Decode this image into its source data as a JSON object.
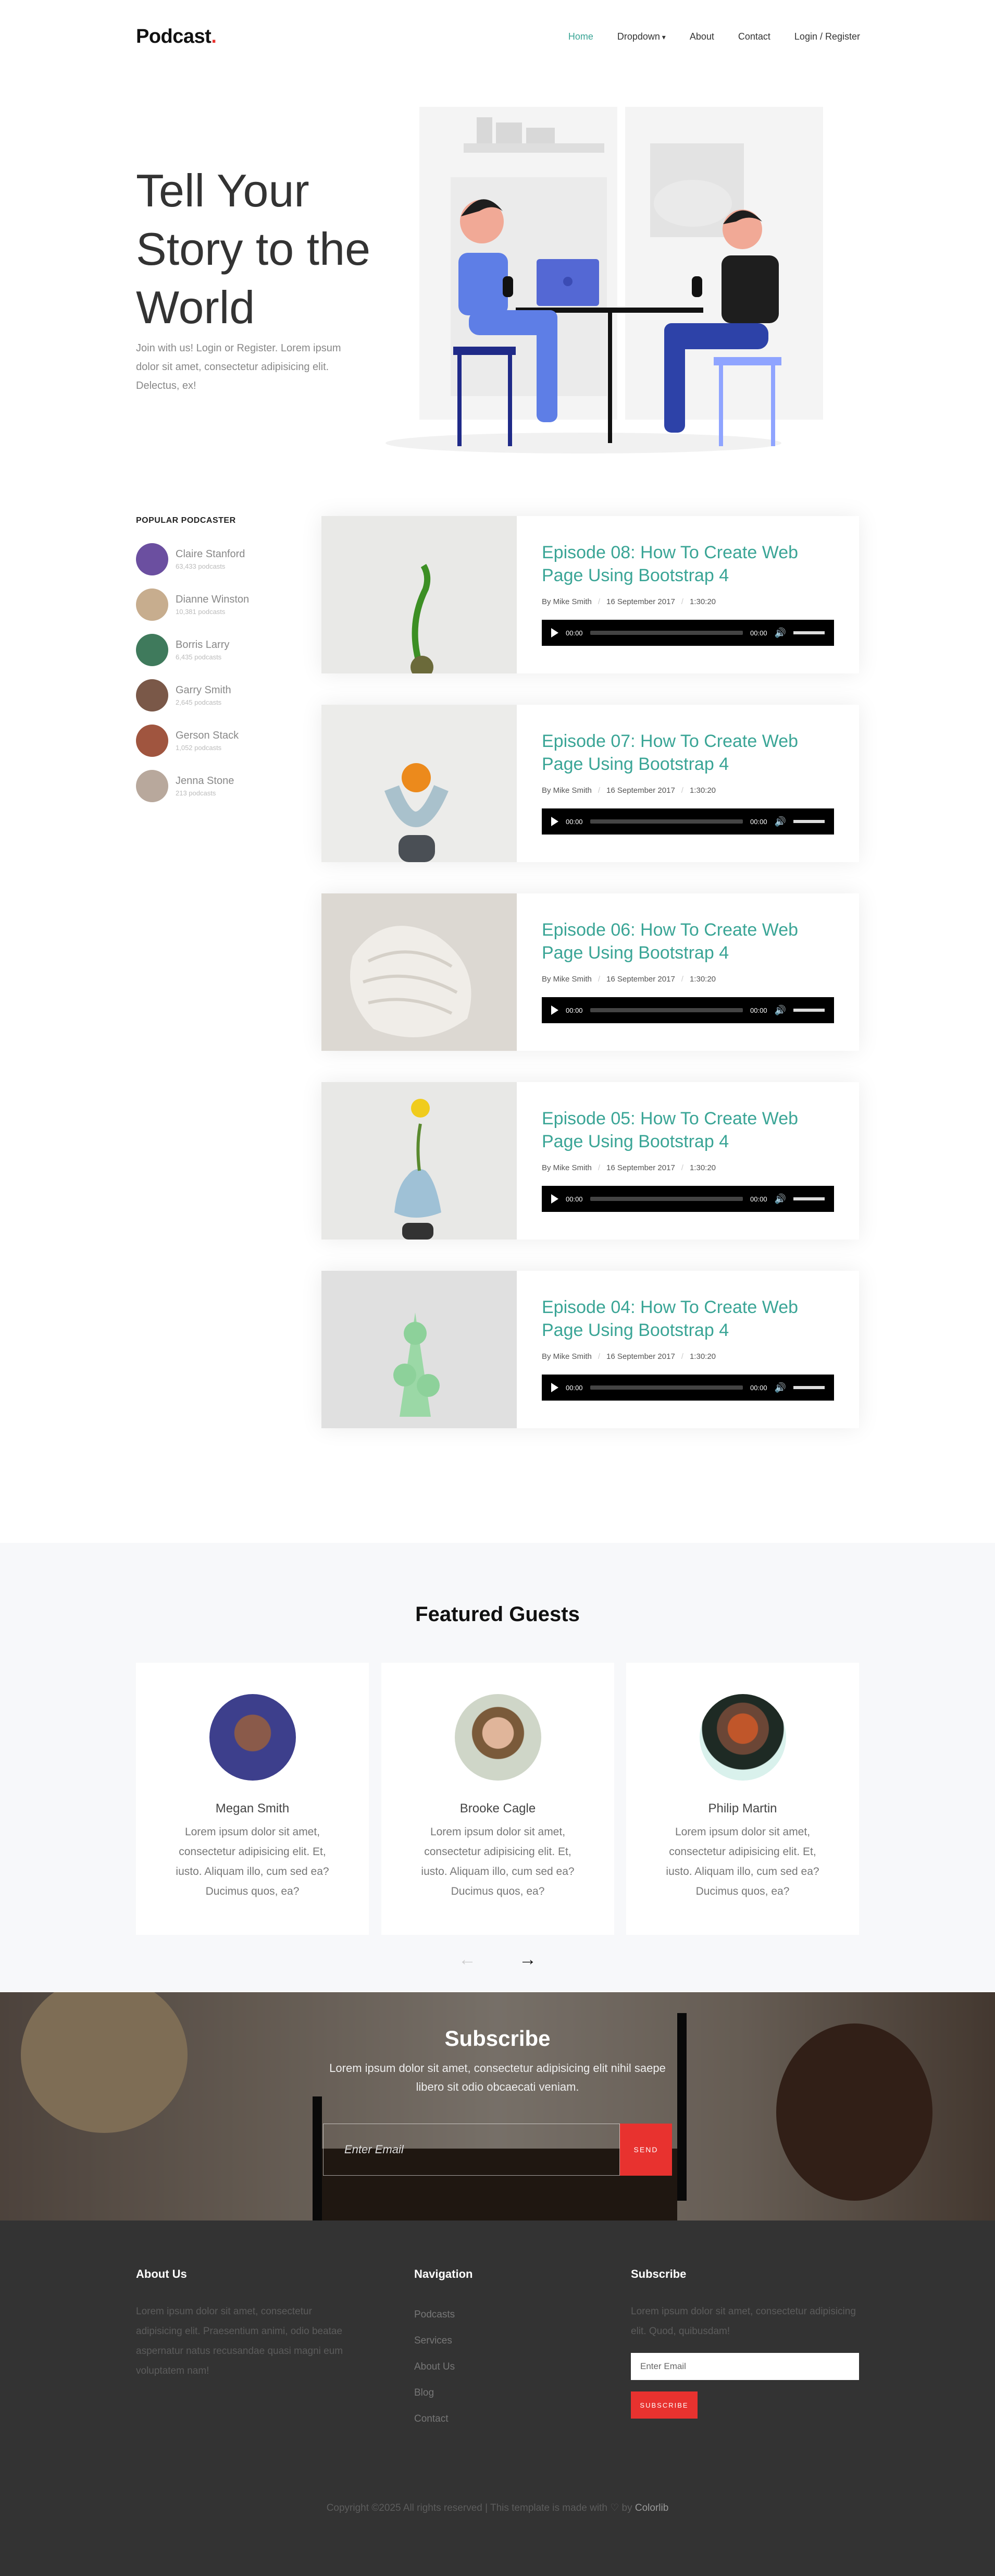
{
  "nav": {
    "logo": "Podcast",
    "logo_dot": ".",
    "items": [
      "Home",
      "Dropdown",
      "About",
      "Contact",
      "Login / Register"
    ]
  },
  "hero": {
    "title": "Tell Your Story to the World",
    "text": "Join with us! Login or Register. Lorem ipsum dolor sit amet, consectetur adipisicing elit. Delectus, ex!"
  },
  "popular": {
    "title": "POPULAR PODCASTER",
    "items": [
      {
        "name": "Claire Stanford",
        "count": "63,433 podcasts"
      },
      {
        "name": "Dianne Winston",
        "count": "10,381 podcasts"
      },
      {
        "name": "Borris Larry",
        "count": "6,435 podcasts"
      },
      {
        "name": "Garry Smith",
        "count": "2,645 podcasts"
      },
      {
        "name": "Gerson Stack",
        "count": "1,052 podcasts"
      },
      {
        "name": "Jenna Stone",
        "count": "213 podcasts"
      }
    ]
  },
  "episodes": [
    {
      "title": "Episode 08: How To Create Web Page Using Bootstrap 4",
      "author": "By Mike Smith",
      "date": "16 September 2017",
      "duration": "1:30:20",
      "time": "00:00",
      "end": "00:00"
    },
    {
      "title": "Episode 07: How To Create Web Page Using Bootstrap 4",
      "author": "By Mike Smith",
      "date": "16 September 2017",
      "duration": "1:30:20",
      "time": "00:00",
      "end": "00:00"
    },
    {
      "title": "Episode 06: How To Create Web Page Using Bootstrap 4",
      "author": "By Mike Smith",
      "date": "16 September 2017",
      "duration": "1:30:20",
      "time": "00:00",
      "end": "00:00"
    },
    {
      "title": "Episode 05: How To Create Web Page Using Bootstrap 4",
      "author": "By Mike Smith",
      "date": "16 September 2017",
      "duration": "1:30:20",
      "time": "00:00",
      "end": "00:00"
    },
    {
      "title": "Episode 04: How To Create Web Page Using Bootstrap 4",
      "author": "By Mike Smith",
      "date": "16 September 2017",
      "duration": "1:30:20",
      "time": "00:00",
      "end": "00:00"
    }
  ],
  "featured": {
    "title": "Featured Guests",
    "guests": [
      {
        "name": "Megan Smith",
        "text": "Lorem ipsum dolor sit amet, consectetur adipisicing elit. Et, iusto. Aliquam illo, cum sed ea? Ducimus quos, ea?"
      },
      {
        "name": "Brooke Cagle",
        "text": "Lorem ipsum dolor sit amet, consectetur adipisicing elit. Et, iusto. Aliquam illo, cum sed ea? Ducimus quos, ea?"
      },
      {
        "name": "Philip Martin",
        "text": "Lorem ipsum dolor sit amet, consectetur adipisicing elit. Et, iusto. Aliquam illo, cum sed ea? Ducimus quos, ea?"
      }
    ],
    "prev": "←",
    "next": "→"
  },
  "subscribe": {
    "title": "Subscribe",
    "text": "Lorem ipsum dolor sit amet, consectetur adipisicing elit nihil saepe libero sit odio obcaecati veniam.",
    "placeholder": "Enter Email",
    "button": "SEND"
  },
  "footer": {
    "about_title": "About Us",
    "about_text": "Lorem ipsum dolor sit amet, consectetur adipisicing elit. Praesentium animi, odio beatae aspernatur natus recusandae quasi magni eum voluptatem nam!",
    "nav_title": "Navigation",
    "nav_links": [
      "Podcasts",
      "Services",
      "About Us",
      "Blog",
      "Contact"
    ],
    "sub_title": "Subscribe",
    "sub_text": "Lorem ipsum dolor sit amet, consectetur adipisicing elit. Quod, quibusdam!",
    "sub_placeholder": "Enter Email",
    "sub_button": "SUBSCRIBE",
    "copyright": "Copyright ©2025 All rights reserved | This template is made with",
    "by": "by",
    "brand": "Colorlib"
  }
}
